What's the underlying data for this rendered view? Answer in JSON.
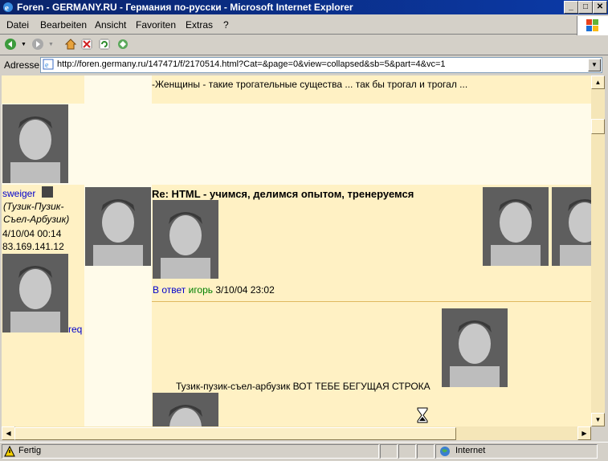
{
  "window": {
    "title": "Foren - GERMANY.RU - Германия по-русски - Microsoft Internet Explorer",
    "buttons": {
      "minimize": "_",
      "maximize": "□",
      "close": "✕"
    }
  },
  "menu": {
    "items": [
      "Datei",
      "Bearbeiten",
      "Ansicht",
      "Favoriten",
      "Extras",
      "?"
    ]
  },
  "address": {
    "label": "Adresse",
    "url": "http://foren.germany.ru/147471/f/2170514.html?Cat=&page=0&view=collapsed&sb=5&part=4&vc=1"
  },
  "content": {
    "prev_post_signature": "-Женщины - такие трогательные существа ... так бы трогал и трогал ...",
    "post": {
      "author": "sweiger",
      "author_subtitle_1": "(Тузик-Пузик-",
      "author_subtitle_2": "Съел-Арбузик)",
      "date": "4/10/04 00:14",
      "ip": "83.169.141.12",
      "reply_link": "req",
      "subject": "Re: HTML - учимся, делимся опытом, тренеруемся",
      "in_reply_prefix": "В ответ",
      "in_reply_user": "игорь",
      "in_reply_date": "3/10/04 23:02",
      "marquee_text": "Тузик-пузик-съел-арбузик ВОТ ТЕБЕ БЕГУЩАЯ СТРОКА"
    },
    "colors": {
      "post_bg": "#fff1c4",
      "post_bg_light": "#fffbea",
      "header_bg": "#fff1c4"
    }
  },
  "status": {
    "text": "Fertig",
    "zone": "Internet"
  }
}
